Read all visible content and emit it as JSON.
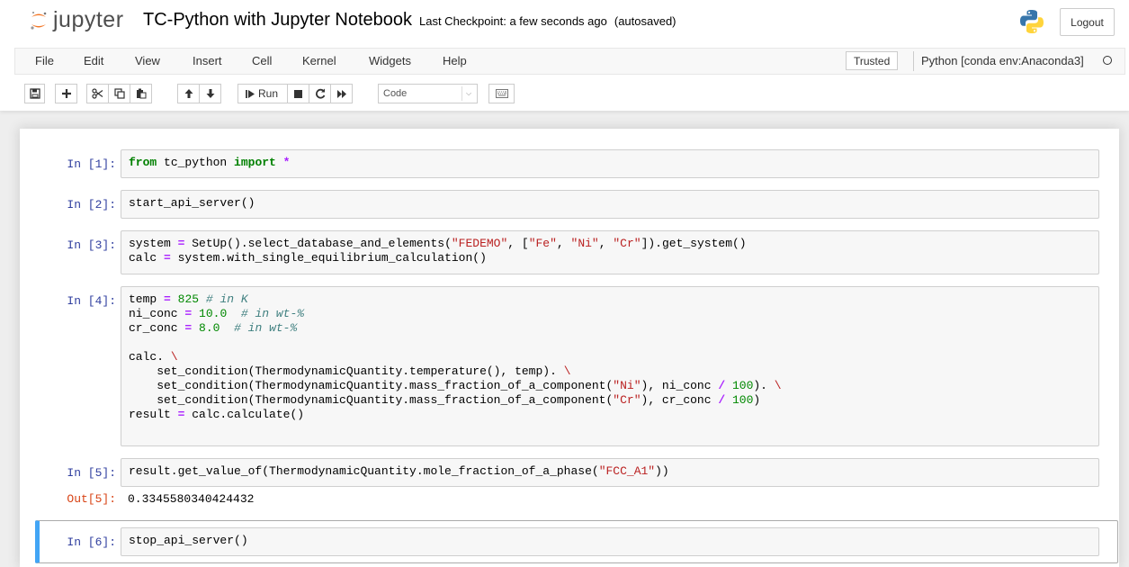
{
  "header": {
    "logo_text": "jupyter",
    "notebook_name": "TC-Python with Jupyter Notebook",
    "checkpoint": "Last Checkpoint: a few seconds ago",
    "autosave_status": "(autosaved)",
    "logout_label": "Logout"
  },
  "menubar": {
    "items": [
      "File",
      "Edit",
      "View",
      "Insert",
      "Cell",
      "Kernel",
      "Widgets",
      "Help"
    ],
    "trusted_label": "Trusted",
    "kernel_name": "Python [conda env:Anaconda3]"
  },
  "toolbar": {
    "run_label": "Run",
    "cell_type": "Code",
    "icons": [
      "save-icon",
      "plus-icon",
      "cut-icon",
      "copy-icon",
      "paste-icon",
      "arrow-up-icon",
      "arrow-down-icon",
      "step-forward-icon",
      "stop-icon",
      "restart-icon",
      "fast-forward-icon",
      "keyboard-icon"
    ]
  },
  "cells": [
    {
      "prompt": "In [1]:",
      "lines": [
        [
          [
            "kw",
            "from"
          ],
          [
            "plain",
            " tc_python "
          ],
          [
            "kw",
            "import"
          ],
          [
            "plain",
            " "
          ],
          [
            "op",
            "*"
          ]
        ]
      ]
    },
    {
      "prompt": "In [2]:",
      "lines": [
        [
          [
            "plain",
            "start_api_server()"
          ]
        ]
      ]
    },
    {
      "prompt": "In [3]:",
      "lines": [
        [
          [
            "plain",
            "system "
          ],
          [
            "op",
            "="
          ],
          [
            "plain",
            " SetUp().select_database_and_elements("
          ],
          [
            "str",
            "\"FEDEMO\""
          ],
          [
            "plain",
            ", ["
          ],
          [
            "str",
            "\"Fe\""
          ],
          [
            "plain",
            ", "
          ],
          [
            "str",
            "\"Ni\""
          ],
          [
            "plain",
            ", "
          ],
          [
            "str",
            "\"Cr\""
          ],
          [
            "plain",
            "]).get_system()"
          ]
        ],
        [
          [
            "plain",
            "calc "
          ],
          [
            "op",
            "="
          ],
          [
            "plain",
            " system.with_single_equilibrium_calculation()"
          ]
        ]
      ]
    },
    {
      "prompt": "In [4]:",
      "lines": [
        [
          [
            "plain",
            "temp "
          ],
          [
            "op",
            "="
          ],
          [
            "plain",
            " "
          ],
          [
            "num",
            "825"
          ],
          [
            "plain",
            " "
          ],
          [
            "cm",
            "# in K"
          ]
        ],
        [
          [
            "plain",
            "ni_conc "
          ],
          [
            "op",
            "="
          ],
          [
            "plain",
            " "
          ],
          [
            "num",
            "10.0"
          ],
          [
            "plain",
            "  "
          ],
          [
            "cm",
            "# in wt-%"
          ]
        ],
        [
          [
            "plain",
            "cr_conc "
          ],
          [
            "op",
            "="
          ],
          [
            "plain",
            " "
          ],
          [
            "num",
            "8.0"
          ],
          [
            "plain",
            "  "
          ],
          [
            "cm",
            "# in wt-%"
          ]
        ],
        [
          [
            "plain",
            ""
          ]
        ],
        [
          [
            "plain",
            "calc. "
          ],
          [
            "str",
            "\\"
          ]
        ],
        [
          [
            "plain",
            "    set_condition(ThermodynamicQuantity.temperature(), temp). "
          ],
          [
            "str",
            "\\"
          ]
        ],
        [
          [
            "plain",
            "    set_condition(ThermodynamicQuantity.mass_fraction_of_a_component("
          ],
          [
            "str",
            "\"Ni\""
          ],
          [
            "plain",
            "), ni_conc "
          ],
          [
            "op",
            "/"
          ],
          [
            "plain",
            " "
          ],
          [
            "num",
            "100"
          ],
          [
            "plain",
            "). "
          ],
          [
            "str",
            "\\"
          ]
        ],
        [
          [
            "plain",
            "    set_condition(ThermodynamicQuantity.mass_fraction_of_a_component("
          ],
          [
            "str",
            "\"Cr\""
          ],
          [
            "plain",
            "), cr_conc "
          ],
          [
            "op",
            "/"
          ],
          [
            "plain",
            " "
          ],
          [
            "num",
            "100"
          ],
          [
            "plain",
            ")"
          ]
        ],
        [
          [
            "plain",
            "result "
          ],
          [
            "op",
            "="
          ],
          [
            "plain",
            " calc.calculate()"
          ]
        ]
      ]
    },
    {
      "prompt": "In [5]:",
      "lines": [
        [
          [
            "plain",
            "result.get_value_of(ThermodynamicQuantity.mole_fraction_of_a_phase("
          ],
          [
            "str",
            "\"FCC_A1\""
          ],
          [
            "plain",
            "))"
          ]
        ]
      ]
    },
    {
      "prompt": "In [6]:",
      "lines": [
        [
          [
            "plain",
            "stop_api_server()"
          ]
        ]
      ]
    }
  ],
  "output": {
    "prompt": "Out[5]:",
    "value": "0.3345580340424432"
  }
}
